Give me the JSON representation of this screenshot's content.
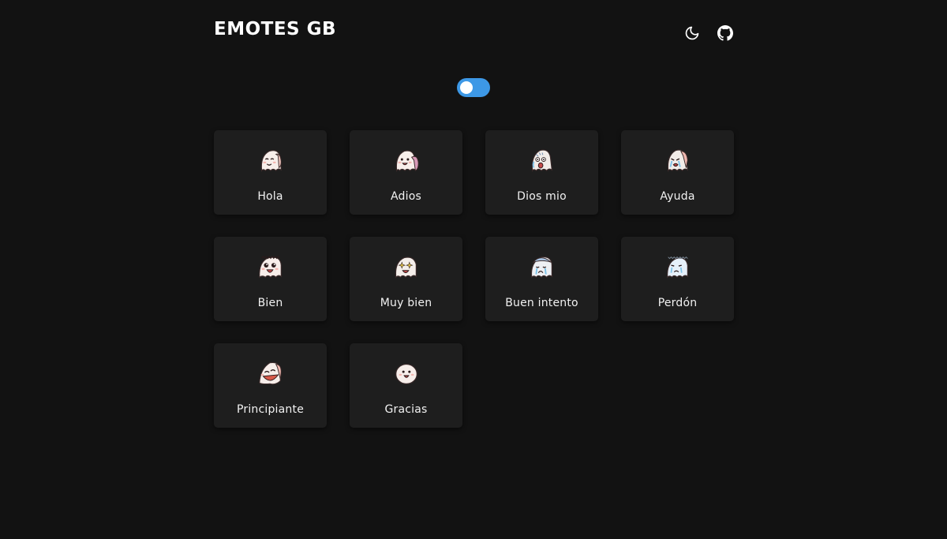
{
  "header": {
    "title": "EMOTES GB",
    "icons": [
      "moon-icon",
      "github-icon"
    ]
  },
  "toggle": {
    "state": "on",
    "accent_color": "#3d98e6"
  },
  "emotes": [
    {
      "label": "Hola",
      "icon": "waving-ghost-emote"
    },
    {
      "label": "Adios",
      "icon": "goodbye-ghost-emote"
    },
    {
      "label": "Dios mio",
      "icon": "shocked-ghost-emote"
    },
    {
      "label": "Ayuda",
      "icon": "crying-ghost-emote"
    },
    {
      "label": "Bien",
      "icon": "happy-ghost-emote"
    },
    {
      "label": "Muy bien",
      "icon": "sparkle-ghost-emote"
    },
    {
      "label": "Buen intento",
      "icon": "sad-ghost-emote"
    },
    {
      "label": "Perdón",
      "icon": "sorry-ghost-emote"
    },
    {
      "label": "Principiante",
      "icon": "laughing-ghost-emote"
    },
    {
      "label": "Gracias",
      "icon": "thankful-ghost-emote"
    }
  ],
  "colors": {
    "background": "#121212",
    "card": "#1e1e1e",
    "text": "#ffffff"
  }
}
